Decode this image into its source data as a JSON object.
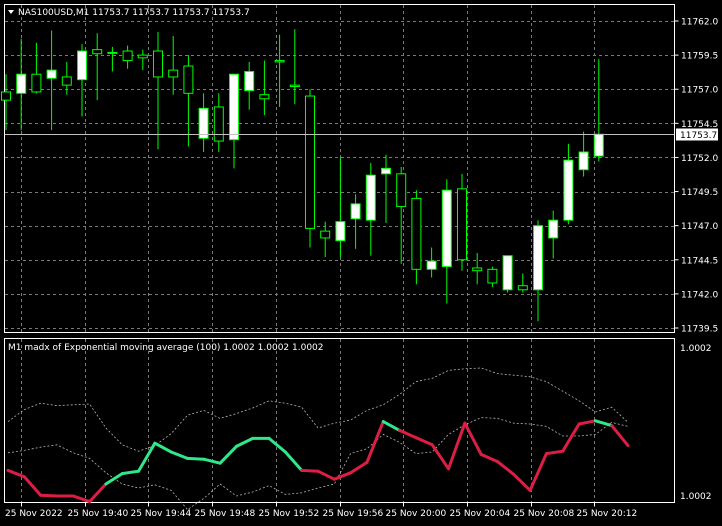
{
  "main_chart": {
    "symbol_header": "NAS100USD,M1  11753.7 11753.7 11753.7 11753.7",
    "current_price": "11753.7",
    "price_axis_labels": [
      "11762.0",
      "11759.5",
      "11757.0",
      "11754.5",
      "11752.0",
      "11749.5",
      "11747.0",
      "11744.5",
      "11742.0",
      "11739.5"
    ],
    "colors": {
      "bull": "#ffffff",
      "bear": "#000000",
      "wick": "#00ff00",
      "grid": "#7a7a7a",
      "border": "#ffffff"
    },
    "candles": [
      {
        "o": 11756.8,
        "h": 11758.1,
        "l": 11754.0,
        "c": 11756.2
      },
      {
        "o": 11756.7,
        "h": 11760.7,
        "l": 11754.0,
        "c": 11758.1
      },
      {
        "o": 11758.1,
        "h": 11760.4,
        "l": 11756.7,
        "c": 11756.8
      },
      {
        "o": 11757.8,
        "h": 11761.3,
        "l": 11754.0,
        "c": 11758.4
      },
      {
        "o": 11757.9,
        "h": 11759.0,
        "l": 11756.6,
        "c": 11757.3
      },
      {
        "o": 11757.7,
        "h": 11760.3,
        "l": 11755.0,
        "c": 11759.8
      },
      {
        "o": 11759.9,
        "h": 11761.1,
        "l": 11756.2,
        "c": 11759.6
      },
      {
        "o": 11759.7,
        "h": 11760.1,
        "l": 11758.3,
        "c": 11759.7
      },
      {
        "o": 11759.8,
        "h": 11760.2,
        "l": 11758.5,
        "c": 11759.1
      },
      {
        "o": 11759.5,
        "h": 11759.9,
        "l": 11758.4,
        "c": 11759.3
      },
      {
        "o": 11759.8,
        "h": 11761.2,
        "l": 11752.6,
        "c": 11757.9
      },
      {
        "o": 11758.4,
        "h": 11760.9,
        "l": 11756.6,
        "c": 11757.9
      },
      {
        "o": 11758.7,
        "h": 11759.5,
        "l": 11752.8,
        "c": 11756.7
      },
      {
        "o": 11753.4,
        "h": 11756.7,
        "l": 11752.4,
        "c": 11755.6
      },
      {
        "o": 11755.7,
        "h": 11756.7,
        "l": 11752.4,
        "c": 11753.2
      },
      {
        "o": 11753.3,
        "h": 11758.0,
        "l": 11751.2,
        "c": 11758.1
      },
      {
        "o": 11756.9,
        "h": 11759.0,
        "l": 11755.5,
        "c": 11758.3
      },
      {
        "o": 11756.6,
        "h": 11759.1,
        "l": 11755.1,
        "c": 11756.3
      },
      {
        "o": 11759.1,
        "h": 11761.0,
        "l": 11755.7,
        "c": 11759.0
      },
      {
        "o": 11757.3,
        "h": 11761.4,
        "l": 11755.9,
        "c": 11757.2
      },
      {
        "o": 11756.5,
        "h": 11757.0,
        "l": 11745.4,
        "c": 11746.8
      },
      {
        "o": 11746.6,
        "h": 11747.3,
        "l": 11744.7,
        "c": 11746.1
      },
      {
        "o": 11745.9,
        "h": 11752.0,
        "l": 11744.7,
        "c": 11747.3
      },
      {
        "o": 11747.5,
        "h": 11749.3,
        "l": 11745.3,
        "c": 11748.6
      },
      {
        "o": 11747.4,
        "h": 11751.6,
        "l": 11744.8,
        "c": 11750.7
      },
      {
        "o": 11750.8,
        "h": 11752.2,
        "l": 11747.2,
        "c": 11751.2
      },
      {
        "o": 11750.8,
        "h": 11751.3,
        "l": 11744.2,
        "c": 11748.4
      },
      {
        "o": 11749.0,
        "h": 11749.6,
        "l": 11742.7,
        "c": 11743.8
      },
      {
        "o": 11743.8,
        "h": 11745.4,
        "l": 11743.2,
        "c": 11744.4
      },
      {
        "o": 11744.0,
        "h": 11750.4,
        "l": 11741.3,
        "c": 11749.6
      },
      {
        "o": 11749.7,
        "h": 11750.8,
        "l": 11743.7,
        "c": 11744.5
      },
      {
        "o": 11743.9,
        "h": 11745.0,
        "l": 11742.7,
        "c": 11743.7
      },
      {
        "o": 11743.8,
        "h": 11744.0,
        "l": 11742.5,
        "c": 11742.8
      },
      {
        "o": 11742.3,
        "h": 11744.8,
        "l": 11742.1,
        "c": 11744.8
      },
      {
        "o": 11742.6,
        "h": 11743.5,
        "l": 11742.1,
        "c": 11742.3
      },
      {
        "o": 11742.3,
        "h": 11747.4,
        "l": 11740.0,
        "c": 11747.0
      },
      {
        "o": 11746.1,
        "h": 11748.1,
        "l": 11744.6,
        "c": 11747.4
      },
      {
        "o": 11747.4,
        "h": 11753.0,
        "l": 11747.1,
        "c": 11751.8
      },
      {
        "o": 11751.1,
        "h": 11753.9,
        "l": 11750.6,
        "c": 11752.4
      },
      {
        "o": 11752.1,
        "h": 11759.2,
        "l": 11751.7,
        "c": 11753.7
      }
    ]
  },
  "indicator": {
    "header": "M1 madx of  Exponential moving average (100) 1.0002 1.0002 1.0002",
    "axis_top": "1.0002",
    "axis_bottom": "1.0002",
    "colors": {
      "up": "#2ee88a",
      "down": "#dc1e45",
      "dash": "#b4b4b4"
    },
    "main_line": [
      0.185,
      0.145,
      0.03,
      0.025,
      0.025,
      -0.01,
      0.1,
      0.165,
      0.18,
      0.355,
      0.3,
      0.26,
      0.255,
      0.23,
      0.335,
      0.385,
      0.385,
      0.3,
      0.185,
      0.18,
      0.13,
      0.17,
      0.235,
      0.49,
      0.435,
      0.39,
      0.345,
      0.195,
      0.48,
      0.285,
      0.24,
      0.16,
      0.06,
      0.29,
      0.305,
      0.475,
      0.495,
      0.465,
      0.34
    ],
    "line_colors": [
      "down",
      "down",
      "down",
      "down",
      "down",
      "down",
      "up",
      "up",
      "up",
      "up",
      "up",
      "up",
      "up",
      "up",
      "up",
      "up",
      "up",
      "up",
      "down",
      "down",
      "down",
      "down",
      "down",
      "up",
      "down",
      "down",
      "down",
      "down",
      "down",
      "down",
      "down",
      "down",
      "down",
      "down",
      "down",
      "down",
      "up",
      "down",
      "down"
    ],
    "dash_upper": [
      0.49,
      0.565,
      0.605,
      0.59,
      0.595,
      0.6,
      0.45,
      0.345,
      0.305,
      0.34,
      0.415,
      0.53,
      0.56,
      0.51,
      0.54,
      0.575,
      0.62,
      0.605,
      0.58,
      0.45,
      0.48,
      0.5,
      0.56,
      0.595,
      0.66,
      0.74,
      0.76,
      0.81,
      0.82,
      0.825,
      0.79,
      0.78,
      0.77,
      0.74,
      0.68,
      0.62,
      0.55,
      0.58,
      0.485
    ],
    "dash_lower": [
      0.295,
      0.31,
      0.33,
      0.345,
      0.295,
      0.26,
      0.17,
      0.1,
      0.075,
      0.095,
      0.06,
      -0.06,
      0.01,
      0.1,
      0.025,
      0.05,
      0.09,
      0.035,
      0.045,
      0.075,
      0.1,
      0.29,
      0.32,
      0.41,
      0.36,
      0.29,
      0.3,
      0.41,
      0.47,
      0.515,
      0.51,
      0.48,
      0.475,
      0.46,
      0.4,
      0.4,
      0.41,
      0.485,
      0.46
    ]
  },
  "time_axis": {
    "labels": [
      "25 Nov 2022",
      "25 Nov 19:40",
      "25 Nov 19:44",
      "25 Nov 19:48",
      "25 Nov 19:52",
      "25 Nov 19:56",
      "25 Nov 20:00",
      "25 Nov 20:04",
      "25 Nov 20:08",
      "25 Nov 20:12"
    ]
  }
}
